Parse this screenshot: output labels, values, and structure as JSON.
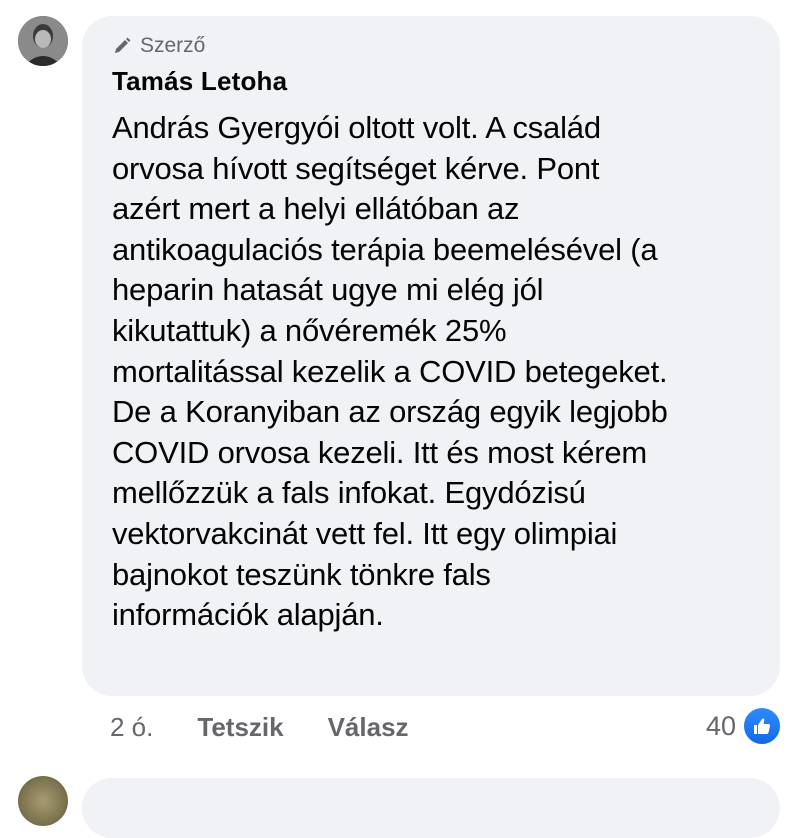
{
  "comment": {
    "badge_label": "Szerző",
    "author": "Tamás Letoha",
    "lines": [
      "András Gyergyói oltott volt. A család",
      "orvosa hívott segítséget kérve. Pont",
      "azért mert a helyi ellátóban az",
      "antikoagulaciós terápia beemelésével (a",
      "heparin hatasát ugye mi elég jól",
      "kikutattuk) a nővéremék 25%",
      "mortalitással kezelik a COVID betegeket.",
      "De a Koranyiban az ország egyik legjobb",
      "COVID orvosa kezeli. Itt és most kérem",
      "mellőzzük a fals infokat. Egydózisú",
      "vektorvakcinát vett fel. Itt egy olimpiai",
      "bajnokot teszünk tönkre fals",
      "információk alapján."
    ],
    "time": "2 ó.",
    "like_label": "Tetszik",
    "reply_label": "Válasz",
    "reaction_count": "40",
    "reaction_icon": "like-icon",
    "colors": {
      "bubble": "#f0f2f5",
      "secondary_text": "#65676b",
      "like_blue": "#1877f2"
    }
  }
}
